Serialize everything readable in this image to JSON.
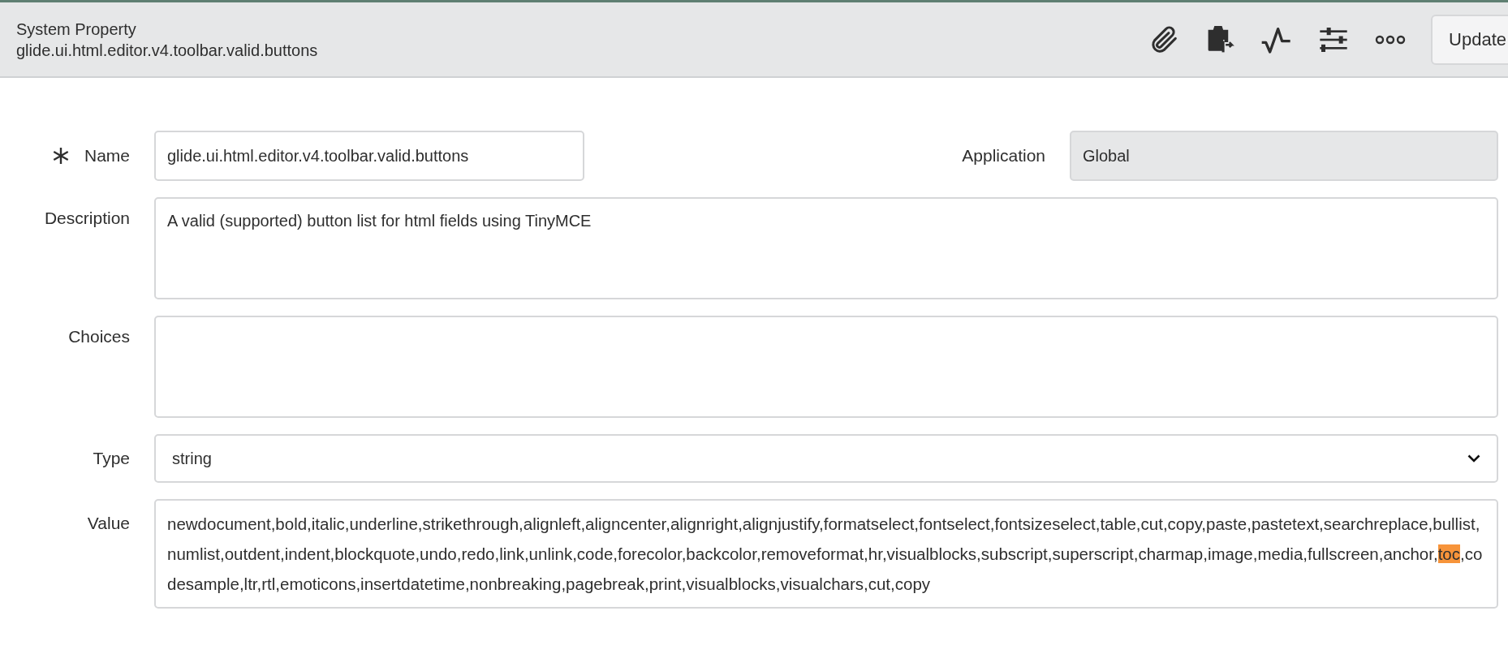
{
  "header": {
    "title": "System Property",
    "subtitle": "glide.ui.html.editor.v4.toolbar.valid.buttons",
    "update_button": "Update"
  },
  "form": {
    "name": {
      "label": "Name",
      "required": true,
      "value": "glide.ui.html.editor.v4.toolbar.valid.buttons"
    },
    "application": {
      "label": "Application",
      "value": "Global",
      "readonly": true
    },
    "description": {
      "label": "Description",
      "value": "A valid (supported) button list for html fields using TinyMCE"
    },
    "choices": {
      "label": "Choices"
    },
    "type": {
      "label": "Type",
      "value": "string"
    },
    "value": {
      "label": "Value",
      "segments": [
        {
          "text": "newdocument,bold,italic,underline,strikethrough,alignleft,aligncenter,alignright,alignjustify,formatselect,fontselect,fontsizeselect,table,cut,copy,paste,pastetext,searchreplace,bullist,numlist,outdent,indent,blockquote,undo,redo,link,unlink,code,forecolor,backcolor,removeformat,hr,visualblocks,subscript,superscript,charmap,image,media,fullscreen,anchor,",
          "highlighted": false
        },
        {
          "text": "toc",
          "highlighted": true
        },
        {
          "text": ",codesample,ltr,rtl,emoticons,insertdatetime,nonbreaking,pagebreak,print,visualblocks,visualchars,cut,copy",
          "highlighted": false
        }
      ]
    }
  }
}
